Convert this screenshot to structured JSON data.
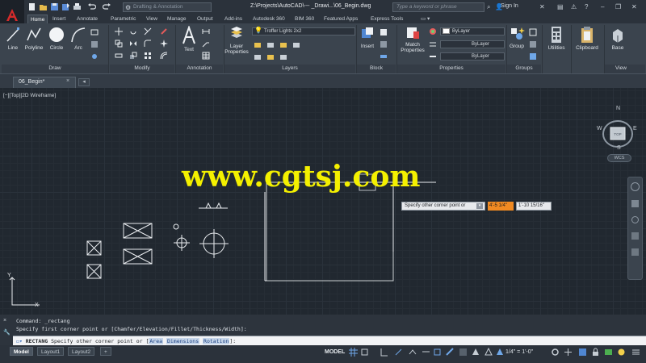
{
  "titlebar": {
    "workspace": "Drafting & Annotation",
    "doc_title": "Z:\\Projects\\AutoCAD\\--- _Drawi...\\06_Begin.dwg",
    "search_placeholder": "Type a keyword or phrase",
    "signin": "Sign In"
  },
  "ribbon_tabs": [
    {
      "label": "Home",
      "active": true
    },
    {
      "label": "Insert"
    },
    {
      "label": "Annotate"
    },
    {
      "label": "Parametric"
    },
    {
      "label": "View"
    },
    {
      "label": "Manage"
    },
    {
      "label": "Output"
    },
    {
      "label": "Add-ins"
    },
    {
      "label": "Autodesk 360"
    },
    {
      "label": "BIM 360"
    },
    {
      "label": "Featured Apps"
    },
    {
      "label": "Express Tools"
    }
  ],
  "ribbon": {
    "draw": {
      "line": "Line",
      "polyline": "Polyline",
      "circle": "Circle",
      "arc": "Arc",
      "panel": "Draw"
    },
    "modify": {
      "panel": "Modify"
    },
    "annotation": {
      "text": "Text",
      "panel": "Annotation"
    },
    "layers": {
      "layer_properties_1": "Layer",
      "layer_properties_2": "Properties",
      "current_layer": "Troffer Lights 2x2",
      "panel": "Layers"
    },
    "block": {
      "insert": "Insert",
      "panel": "Block"
    },
    "properties": {
      "match_1": "Match",
      "match_2": "Properties",
      "color": "ByLayer",
      "linetype": "ByLayer",
      "lineweight": "ByLayer",
      "panel": "Properties"
    },
    "groups": {
      "group": "Group",
      "panel": "Groups"
    },
    "utilities": {
      "label": "Utilities"
    },
    "clipboard": {
      "label": "Clipboard"
    },
    "view": {
      "base": "Base",
      "panel": "View"
    }
  },
  "doc_tabs": {
    "active": "06_Begin*"
  },
  "viewport": {
    "label": "[−][Top][2D Wireframe]"
  },
  "watermark": "www.cgtsj.com",
  "dynamic_input": {
    "prompt": "Specify other corner point or",
    "x_value": "4'-5 1/4\"",
    "y_value": "1'-10 15/16\""
  },
  "viewcube": {
    "n": "N",
    "s": "S",
    "e": "E",
    "w": "W",
    "face": "TOP",
    "wcs": "WCS"
  },
  "ucs": {
    "x": "X",
    "y": "Y"
  },
  "command_line": {
    "history_1": "Command: _rectang",
    "history_2": "Specify first corner point or [Chamfer/Elevation/Fillet/Thickness/Width]:",
    "current_cmd": "RECTANG",
    "current_text": " Specify other corner point or [",
    "opt_area": "Area",
    "opt_dim": "Dimensions",
    "opt_rot": "Rotation",
    "current_end": "]:"
  },
  "statusbar": {
    "layouts": [
      {
        "label": "Model",
        "active": true
      },
      {
        "label": "Layout1"
      },
      {
        "label": "Layout2"
      }
    ],
    "model": "MODEL",
    "scale": "1/4\" = 1'-0\""
  },
  "colors": {
    "accent": "#f08a22",
    "watermark": "#f4f000",
    "canvas": "#212830"
  }
}
